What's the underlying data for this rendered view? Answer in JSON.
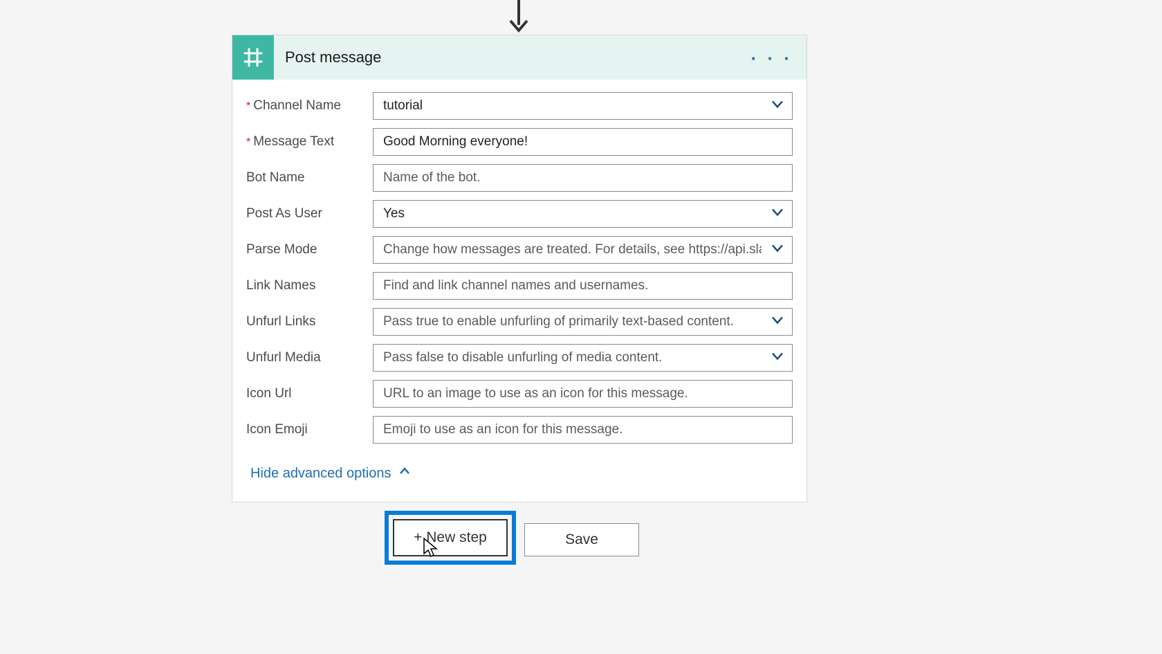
{
  "card": {
    "title": "Post message",
    "ellipsis": "· · ·",
    "fields": {
      "channel_name": {
        "label": "Channel Name",
        "value": "tutorial",
        "required": true,
        "dropdown": true
      },
      "message_text": {
        "label": "Message Text",
        "value": "Good Morning everyone!",
        "required": true,
        "dropdown": false
      },
      "bot_name": {
        "label": "Bot Name",
        "placeholder": "Name of the bot.",
        "required": false,
        "dropdown": false
      },
      "post_as_user": {
        "label": "Post As User",
        "value": "Yes",
        "required": false,
        "dropdown": true
      },
      "parse_mode": {
        "label": "Parse Mode",
        "placeholder": "Change how messages are treated. For details, see https://api.slack.com/c",
        "required": false,
        "dropdown": true
      },
      "link_names": {
        "label": "Link Names",
        "placeholder": "Find and link channel names and usernames.",
        "required": false,
        "dropdown": false
      },
      "unfurl_links": {
        "label": "Unfurl Links",
        "placeholder": "Pass true to enable unfurling of primarily text-based content.",
        "required": false,
        "dropdown": true
      },
      "unfurl_media": {
        "label": "Unfurl Media",
        "placeholder": "Pass false to disable unfurling of media content.",
        "required": false,
        "dropdown": true
      },
      "icon_url": {
        "label": "Icon Url",
        "placeholder": "URL to an image to use as an icon for this message.",
        "required": false,
        "dropdown": false
      },
      "icon_emoji": {
        "label": "Icon Emoji",
        "placeholder": "Emoji to use as an icon for this message.",
        "required": false,
        "dropdown": false
      }
    },
    "advanced_toggle": "Hide advanced options"
  },
  "footer": {
    "new_step": "+ New step",
    "save": "Save"
  }
}
